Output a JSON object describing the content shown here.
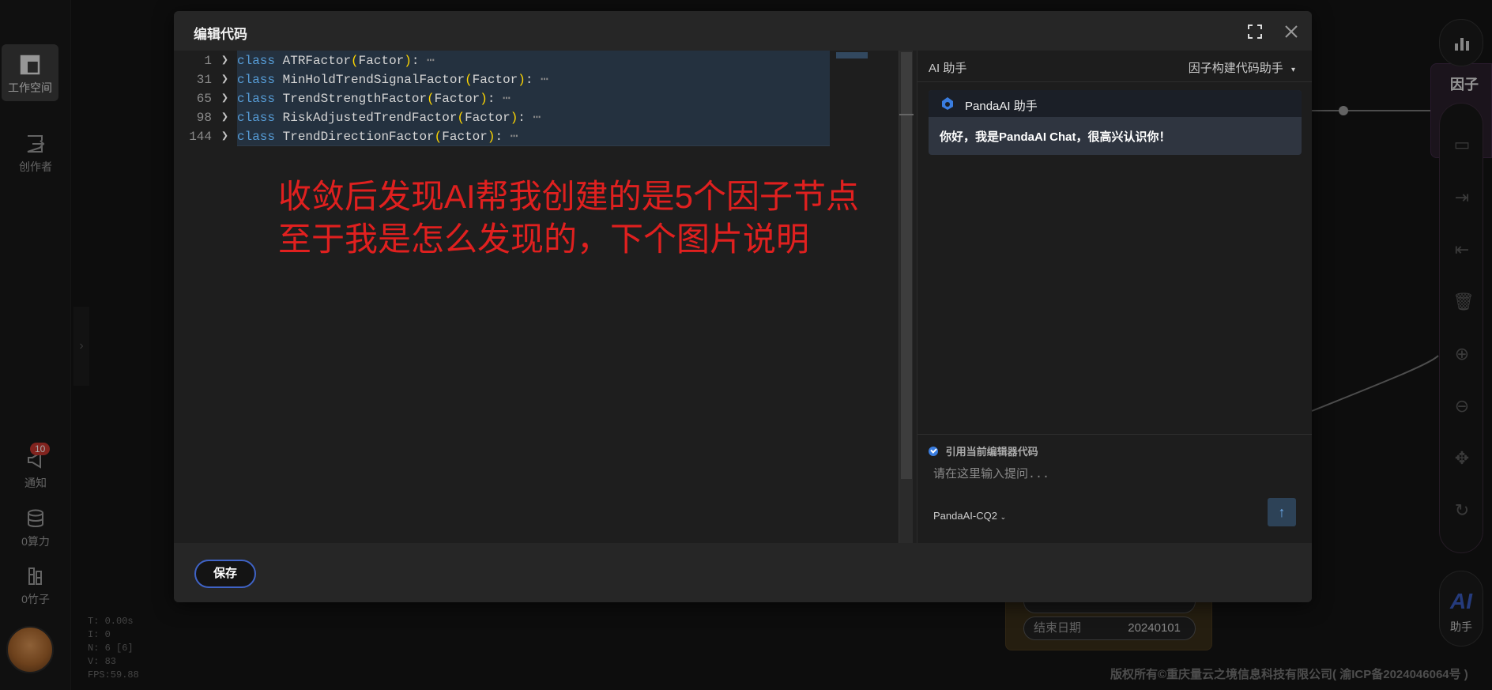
{
  "left_nav": {
    "workspace_label": "工作空间",
    "creator_label": "创作者",
    "notify_label": "通知",
    "notify_badge": "10",
    "compute_label": "0算力",
    "bamboo_label": "0竹子"
  },
  "stats": {
    "t": "T: 0.00s",
    "i": "I: 0",
    "n": "N: 6 [6]",
    "v": "V: 83",
    "fps": "FPS:59.88"
  },
  "background_node": {
    "end_date_label": "结束日期",
    "end_date_value": "20240101",
    "top_node_fragment": "因子"
  },
  "ai_fab_text": "AI",
  "ai_fab_label": "助手",
  "footer_copyright": "版权所有©重庆量云之境信息科技有限公司( 渝ICP备2024046064号 )",
  "modal": {
    "title": "编辑代码",
    "save_label": "保存",
    "code_lines": [
      {
        "line": "1",
        "keyword": "class",
        "name": "ATRFactor",
        "base": "Factor",
        "ellipsis": "⋯"
      },
      {
        "line": "31",
        "keyword": "class",
        "name": "MinHoldTrendSignalFactor",
        "base": "Factor",
        "ellipsis": "⋯"
      },
      {
        "line": "65",
        "keyword": "class",
        "name": "TrendStrengthFactor",
        "base": "Factor",
        "ellipsis": "⋯"
      },
      {
        "line": "98",
        "keyword": "class",
        "name": "RiskAdjustedTrendFactor",
        "base": "Factor",
        "ellipsis": "⋯"
      },
      {
        "line": "144",
        "keyword": "class",
        "name": "TrendDirectionFactor",
        "base": "Factor",
        "ellipsis": "⋯"
      }
    ],
    "annotation_line1": "收敛后发现AI帮我创建的是5个因子节点",
    "annotation_line2": "至于我是怎么发现的，下个图片说明"
  },
  "ai_panel": {
    "title": "AI 助手",
    "mode": "因子构建代码助手",
    "bot_name": "PandaAI 助手",
    "greeting": "你好，我是PandaAI Chat，很高兴认识你！",
    "quote_label": "引用当前编辑器代码",
    "input_placeholder": "请在这里输入提问...",
    "model": "PandaAI-CQ2"
  },
  "colors": {
    "accent": "#3f63c6",
    "annotation": "#e0201f",
    "keyword": "#569cd6",
    "paren": "#ffd700"
  }
}
